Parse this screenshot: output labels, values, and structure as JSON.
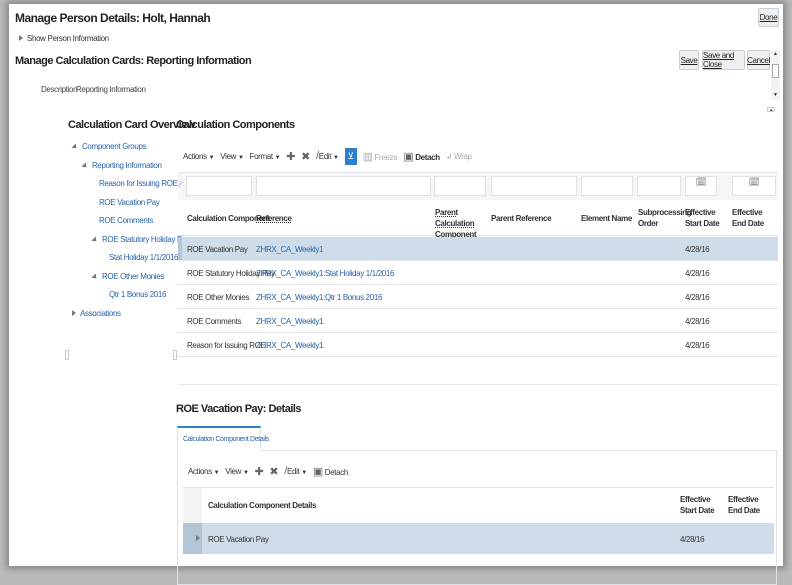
{
  "header": {
    "title": "Manage Person Details: Holt, Hannah",
    "done": "Done",
    "show_person_info": "Show Person Information"
  },
  "page": {
    "title": "Manage Calculation Cards: Reporting Information",
    "save": "Save",
    "save_close": "Save and Close",
    "cancel": "Cancel",
    "description_label": "Description",
    "description_value": "Reporting Information"
  },
  "overview": {
    "title": "Calculation Card Overview",
    "items": [
      "Component Groups",
      "Reporting Information",
      "Reason for Issuing ROE",
      "ROE Vacation Pay",
      "ROE Comments",
      "ROE Statutory Holiday Pay",
      "Stat Holiday 1/1/2016",
      "ROE Other Monies",
      "Qtr 1 Bonus 2016",
      "Associations"
    ]
  },
  "components": {
    "title": "Calculation Components",
    "toolbar": {
      "actions": "Actions",
      "view": "View",
      "format": "Format",
      "edit": "Edit",
      "freeze": "Freeze",
      "detach": "Detach",
      "wrap": "Wrap"
    },
    "columns": [
      "Calculation Component",
      "Reference",
      "Parent Calculation Component",
      "Parent Reference",
      "Element Name",
      "Subprocessing Order",
      "Effective Start Date",
      "Effective End Date"
    ],
    "rows": [
      {
        "component": "ROE Vacation Pay",
        "reference": "ZHRX_CA_Weekly1",
        "start": "4/28/16"
      },
      {
        "component": "ROE Statutory Holiday Pay",
        "reference": "ZHRX_CA_Weekly1:Stat Holiday 1/1/2016",
        "start": "4/28/16"
      },
      {
        "component": "ROE Other Monies",
        "reference": "ZHRX_CA_Weekly1:Qtr 1 Bonus 2016",
        "start": "4/28/16"
      },
      {
        "component": "ROE Comments",
        "reference": "ZHRX_CA_Weekly1",
        "start": "4/28/16"
      },
      {
        "component": "Reason for Issuing ROE",
        "reference": "ZHRX_CA_Weekly1",
        "start": "4/28/16"
      }
    ]
  },
  "details": {
    "title": "ROE Vacation Pay: Details",
    "tab": "Calculation Component Details",
    "toolbar": {
      "actions": "Actions",
      "view": "View",
      "edit": "Edit",
      "detach": "Detach"
    },
    "columns": [
      "Calculation Component Details",
      "Effective Start Date",
      "Effective End Date"
    ],
    "rows": [
      {
        "detail": "ROE Vacation Pay",
        "start": "4/28/16"
      }
    ]
  }
}
